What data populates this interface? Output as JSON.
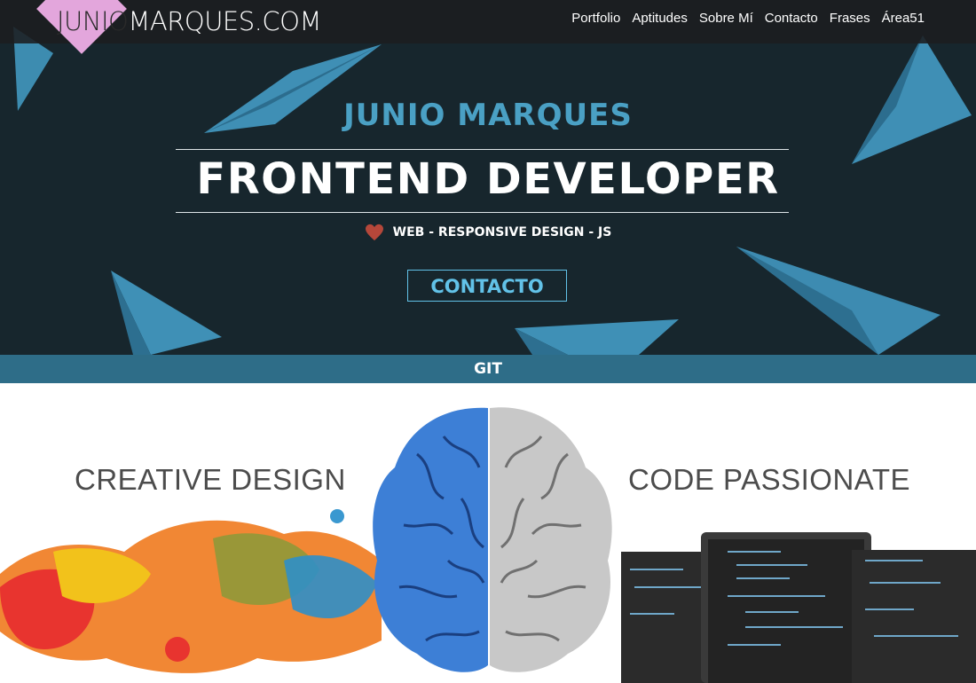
{
  "logo": {
    "part_a": "JUNIO",
    "part_b": "MARQUES.COM"
  },
  "nav": {
    "links": [
      "Portfolio",
      "Aptitudes",
      "Sobre Mí",
      "Contacto",
      "Frases",
      "Área51"
    ]
  },
  "hero": {
    "name": "JUNIO MARQUES",
    "role": "FRONTEND DEVELOPER",
    "tags": "WEB - RESPONSIVE DESIGN - JS",
    "button": "CONTACTO"
  },
  "git_bar": {
    "label": "GIT"
  },
  "banner": {
    "left_text": "CREATIVE DESIGN",
    "right_text": "CODE PASSIONATE"
  },
  "colors": {
    "hero_bg": "#17262d",
    "accent": "#4aa0c4",
    "button": "#62c2e8",
    "git_bar": "#2e6d88",
    "logo_diamond": "#e3a6dc"
  }
}
